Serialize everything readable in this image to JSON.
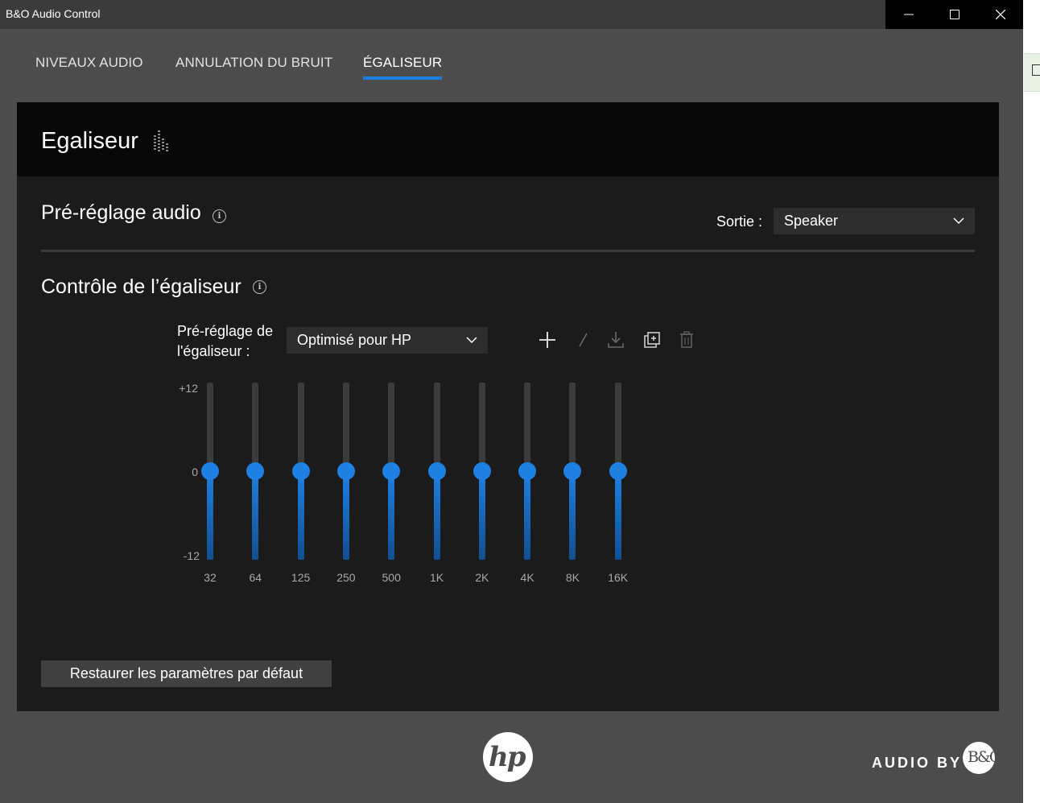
{
  "window": {
    "title": "B&O Audio Control"
  },
  "tabs": [
    {
      "label": "NIVEAUX AUDIO",
      "active": false
    },
    {
      "label": "ANNULATION DU BRUIT",
      "active": false
    },
    {
      "label": "ÉGALISEUR",
      "active": true
    }
  ],
  "panel": {
    "title": "Egaliseur"
  },
  "preset": {
    "title": "Pré-réglage audio",
    "output_label": "Sortie :",
    "output_value": "Speaker"
  },
  "control": {
    "title": "Contrôle de l’égaliseur",
    "eq_preset_label": "Pré-réglage de l'égaliseur :",
    "eq_preset_value": "Optimisé pour HP",
    "toolbar_icons": [
      "add-icon",
      "edit-icon",
      "download-icon",
      "duplicate-icon",
      "delete-icon"
    ],
    "axis_labels": {
      "top": "+12",
      "mid": "0",
      "bottom": "-12"
    },
    "bands": [
      {
        "freq": "32",
        "gain_db": 0
      },
      {
        "freq": "64",
        "gain_db": 0
      },
      {
        "freq": "125",
        "gain_db": 0
      },
      {
        "freq": "250",
        "gain_db": 0
      },
      {
        "freq": "500",
        "gain_db": 0
      },
      {
        "freq": "1K",
        "gain_db": 0
      },
      {
        "freq": "2K",
        "gain_db": 0
      },
      {
        "freq": "4K",
        "gain_db": 0
      },
      {
        "freq": "8K",
        "gain_db": 0
      },
      {
        "freq": "16K",
        "gain_db": 0
      }
    ]
  },
  "restore_button": "Restaurer les paramètres par défaut",
  "footer": {
    "hp_logo_text": "hp",
    "audio_by": "AUDIO BY",
    "bo_logo_text": "B&O"
  },
  "colors": {
    "accent": "#1e80e3",
    "panel_bg": "#1b1b1b",
    "window_bg": "#4c4c4c"
  }
}
